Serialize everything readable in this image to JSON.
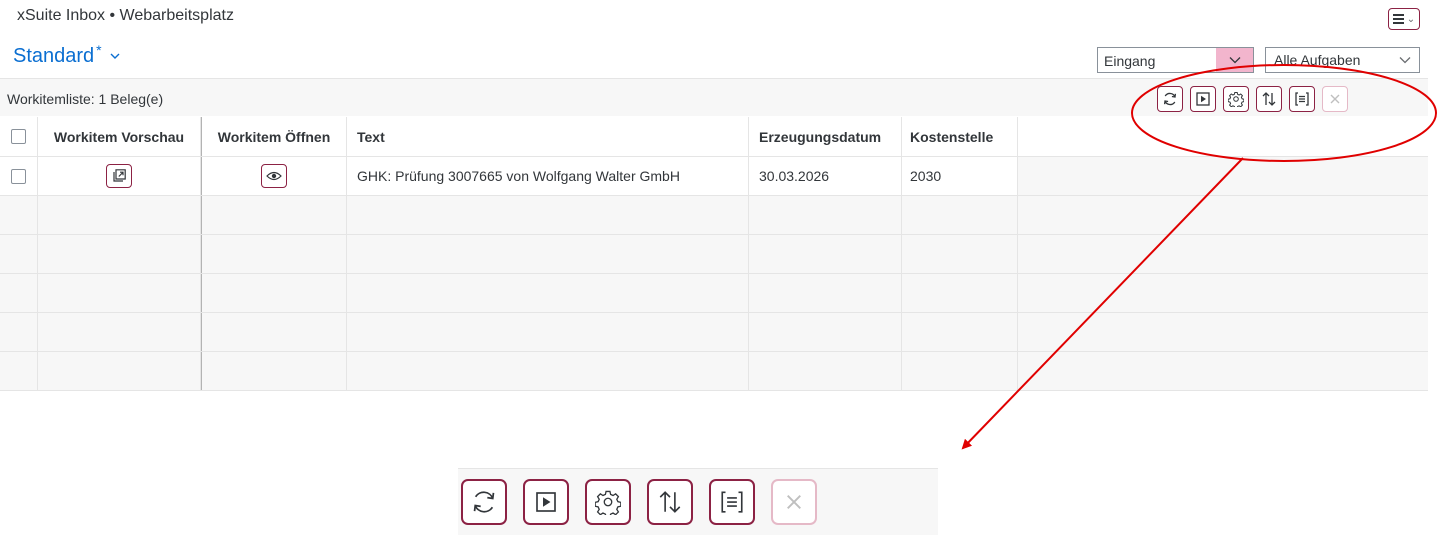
{
  "app": {
    "title": "xSuite Inbox • Webarbeitsplatz"
  },
  "header": {
    "menu_icon": "hamburger-menu-icon",
    "variant": {
      "title": "Standard",
      "modified_marker": "*"
    }
  },
  "filters": {
    "status": {
      "value": "Eingang"
    },
    "tasks": {
      "value": "Alle Aufgaben"
    }
  },
  "table": {
    "title": "Workitemliste: 1 Beleg(e)",
    "columns": [
      "Workitem Vorschau",
      "Workitem Öffnen",
      "Text",
      "Erzeugungsdatum",
      "Kostenstelle"
    ],
    "rows": [
      {
        "text": "GHK: Prüfung 3007665 von Wolfgang Walter GmbH",
        "date": "30.03.2026",
        "cost_center": "2030"
      }
    ],
    "empty_rows": 5
  },
  "toolbar": {
    "buttons": [
      {
        "icon": "refresh-icon",
        "enabled": true
      },
      {
        "icon": "play-icon",
        "enabled": true
      },
      {
        "icon": "gear-icon",
        "enabled": true
      },
      {
        "icon": "sort-icon",
        "enabled": true
      },
      {
        "icon": "group-icon",
        "enabled": true
      },
      {
        "icon": "close-icon",
        "enabled": false
      }
    ]
  },
  "colors": {
    "accent": "#8c2244",
    "link": "#0a6ed1",
    "annotation": "#e00000",
    "select_arrow_bg": "#f2b5cd"
  }
}
